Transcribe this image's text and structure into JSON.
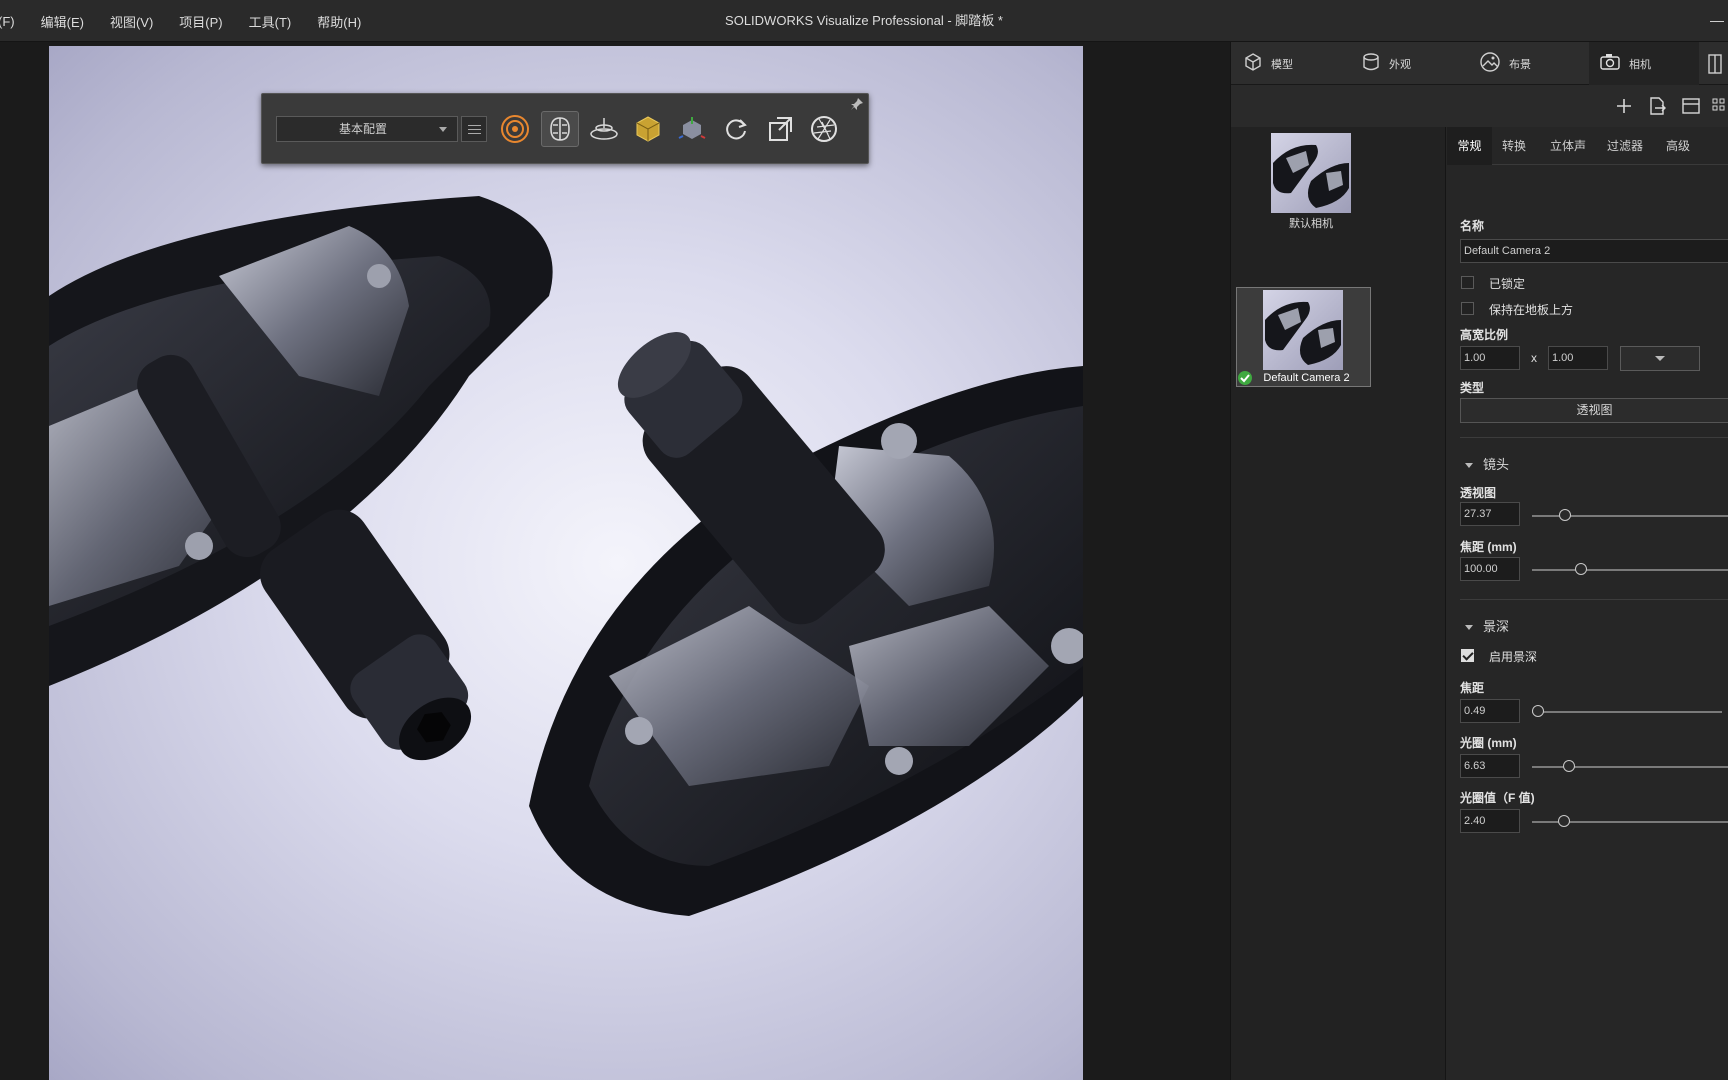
{
  "menu": {
    "items": [
      "(F)",
      "编辑(E)",
      "视图(V)",
      "项目(P)",
      "工具(T)",
      "帮助(H)"
    ]
  },
  "window": {
    "title": "SOLIDWORKS Visualize Professional - 脚踏板 *"
  },
  "viewport_toolbar": {
    "config_value": "基本配置",
    "icons": [
      "render-mode-icon",
      "interaction-mode-icon",
      "floor-icon",
      "object-select-icon",
      "transform-icon",
      "reset-rotate-icon",
      "camera-view-icon",
      "aperture-icon"
    ]
  },
  "main_tabs": [
    {
      "label": "模型",
      "icon": "cube-icon"
    },
    {
      "label": "外观",
      "icon": "cylinder-icon"
    },
    {
      "label": "布景",
      "icon": "scene-icon"
    },
    {
      "label": "相机",
      "icon": "camera-icon"
    }
  ],
  "cameras": [
    {
      "label": "默认相机",
      "selected": false
    },
    {
      "label": "Default Camera 2",
      "selected": true
    }
  ],
  "sub_tabs": [
    "常规",
    "转换",
    "立体声",
    "过滤器",
    "高级"
  ],
  "general": {
    "name_label": "名称",
    "name_value": "Default Camera 2",
    "locked_label": "已锁定",
    "locked": false,
    "keep_above_floor_label": "保持在地板上方",
    "keep_above_floor": false,
    "aspect_label": "高宽比例",
    "aspect_w": "1.00",
    "aspect_x": "x",
    "aspect_h": "1.00",
    "type_label": "类型",
    "type_value": "透视图"
  },
  "lens": {
    "section_label": "镜头",
    "fov_label": "透视图",
    "fov_value": "27.37",
    "fov_slider": 0.17,
    "focal_label": "焦距 (mm)",
    "focal_value": "100.00",
    "focal_slider": 0.25
  },
  "dof": {
    "section_label": "景深",
    "enable_label": "启用景深",
    "enabled": true,
    "focus_label": "焦距",
    "focus_value": "0.49",
    "focus_slider": 0.03,
    "aperture_label": "光圈 (mm)",
    "aperture_value": "6.63",
    "aperture_slider": 0.19,
    "fstop_label": "光圈值（F 值)",
    "fstop_value": "2.40",
    "fstop_slider": 0.16
  },
  "colors": {
    "accent_check": "#3fa940",
    "panel_bg": "#262626",
    "viewport_bg": "#dcdcee"
  }
}
